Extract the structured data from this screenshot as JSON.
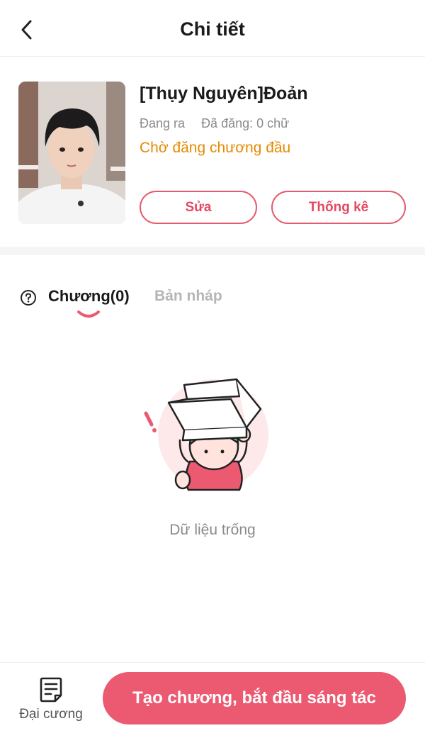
{
  "header": {
    "title": "Chi tiết",
    "back_icon": "chevron-left-icon"
  },
  "book": {
    "title": "[Thụy Nguyên]Đoản",
    "state": "Đang ra",
    "word_count": "Đã đăng: 0 chữ",
    "status": "Chờ đăng chương đầu",
    "edit_label": "Sửa",
    "stats_label": "Thống kê"
  },
  "tabs": {
    "help_icon": "question-circle-icon",
    "chapters_label": "Chương(0)",
    "drafts_label": "Bản nháp"
  },
  "empty_state": {
    "text": "Dữ liệu trống"
  },
  "bottom": {
    "outline_label": "Đại cương",
    "create_label": "Tạo chương, bắt đầu sáng tác"
  },
  "colors": {
    "accent": "#ec5a72",
    "status": "#e58a00",
    "muted": "#8a8a8a"
  }
}
